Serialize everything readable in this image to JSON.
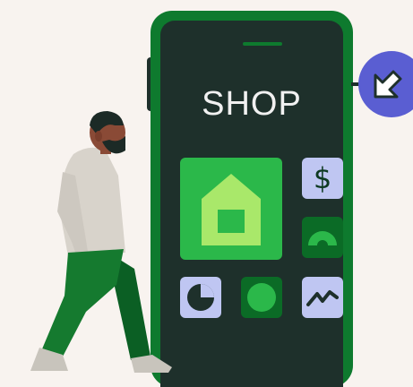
{
  "phone": {
    "title": "SHOP"
  },
  "tiles": {
    "dollar_symbol": "$"
  },
  "icons": {
    "home": "home-icon",
    "dollar": "dollar-icon",
    "gauge": "gauge-icon",
    "pie": "pie-chart-icon",
    "circle": "circle-icon",
    "trend": "trend-line-icon",
    "arrow": "arrow-down-left-icon"
  },
  "colors": {
    "background": "#f8f3ef",
    "phone_frame": "#0e7a2e",
    "phone_screen": "#1e302b",
    "accent_green": "#2bb84a",
    "light_green": "#a9e86a",
    "lavender": "#bfc6f2",
    "badge_blue": "#5a5ed2"
  }
}
